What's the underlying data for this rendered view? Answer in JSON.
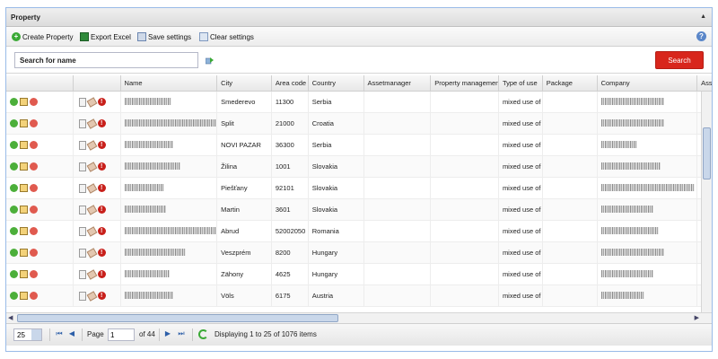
{
  "panel": {
    "title": "Property"
  },
  "toolbar": {
    "create_label": "Create Property",
    "export_label": "Export Excel",
    "save_label": "Save settings",
    "clear_label": "Clear settings",
    "help_glyph": "?"
  },
  "search": {
    "placeholder": "Search for name",
    "button_label": "Search"
  },
  "grid": {
    "columns": [
      "Name",
      "City",
      "Area code",
      "Country",
      "Assetmanager",
      "Property management",
      "Type of use",
      "Package",
      "Company",
      "Ass"
    ],
    "rows": [
      {
        "city": "Smederevo",
        "area": "11300",
        "country": "Serbia",
        "use": "mixed use of"
      },
      {
        "city": "Split",
        "area": "21000",
        "country": "Croatia",
        "use": "mixed use of"
      },
      {
        "city": "NOVI PAZAR",
        "area": "36300",
        "country": "Serbia",
        "use": "mixed use of"
      },
      {
        "city": "Žilina",
        "area": "1001",
        "country": "Slovakia",
        "use": "mixed use of"
      },
      {
        "city": "Piešťany",
        "area": "92101",
        "country": "Slovakia",
        "use": "mixed use of"
      },
      {
        "city": "Martin",
        "area": "3601",
        "country": "Slovakia",
        "use": "mixed use of"
      },
      {
        "city": "Abrud",
        "area": "52002050",
        "country": "Romania",
        "use": "mixed use of"
      },
      {
        "city": "Veszprém",
        "area": "8200",
        "country": "Hungary",
        "use": "mixed use of"
      },
      {
        "city": "Zähony",
        "area": "4625",
        "country": "Hungary",
        "use": "mixed use of"
      },
      {
        "city": "Völs",
        "area": "6175",
        "country": "Austria",
        "use": "mixed use of"
      }
    ]
  },
  "pager": {
    "page_size": "25",
    "page_label": "Page",
    "page_value": "1",
    "of_label": "of 44",
    "display_text": "Displaying 1 to 25 of 1076 items"
  }
}
